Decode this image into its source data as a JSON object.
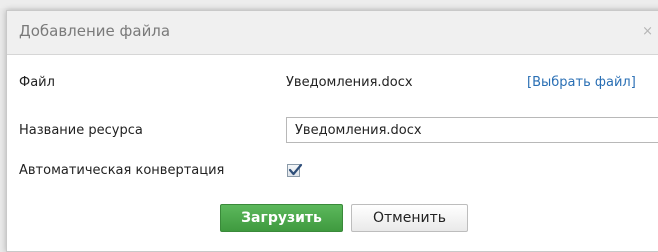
{
  "dialog": {
    "title": "Добавление файла",
    "close_glyph": "×"
  },
  "form": {
    "file_label": "Файл",
    "file_value": "Уведомления.docx",
    "choose_file_link": "[Выбрать файл]",
    "resource_name_label": "Название ресурса",
    "resource_name_value": "Уведомления.docx",
    "auto_convert_label": "Автоматическая конвертация",
    "auto_convert_checked": true
  },
  "buttons": {
    "upload_label": "Загрузить",
    "cancel_label": "Отменить"
  },
  "colors": {
    "upload_button": "#4cae4c",
    "link": "#2a6fb4"
  }
}
